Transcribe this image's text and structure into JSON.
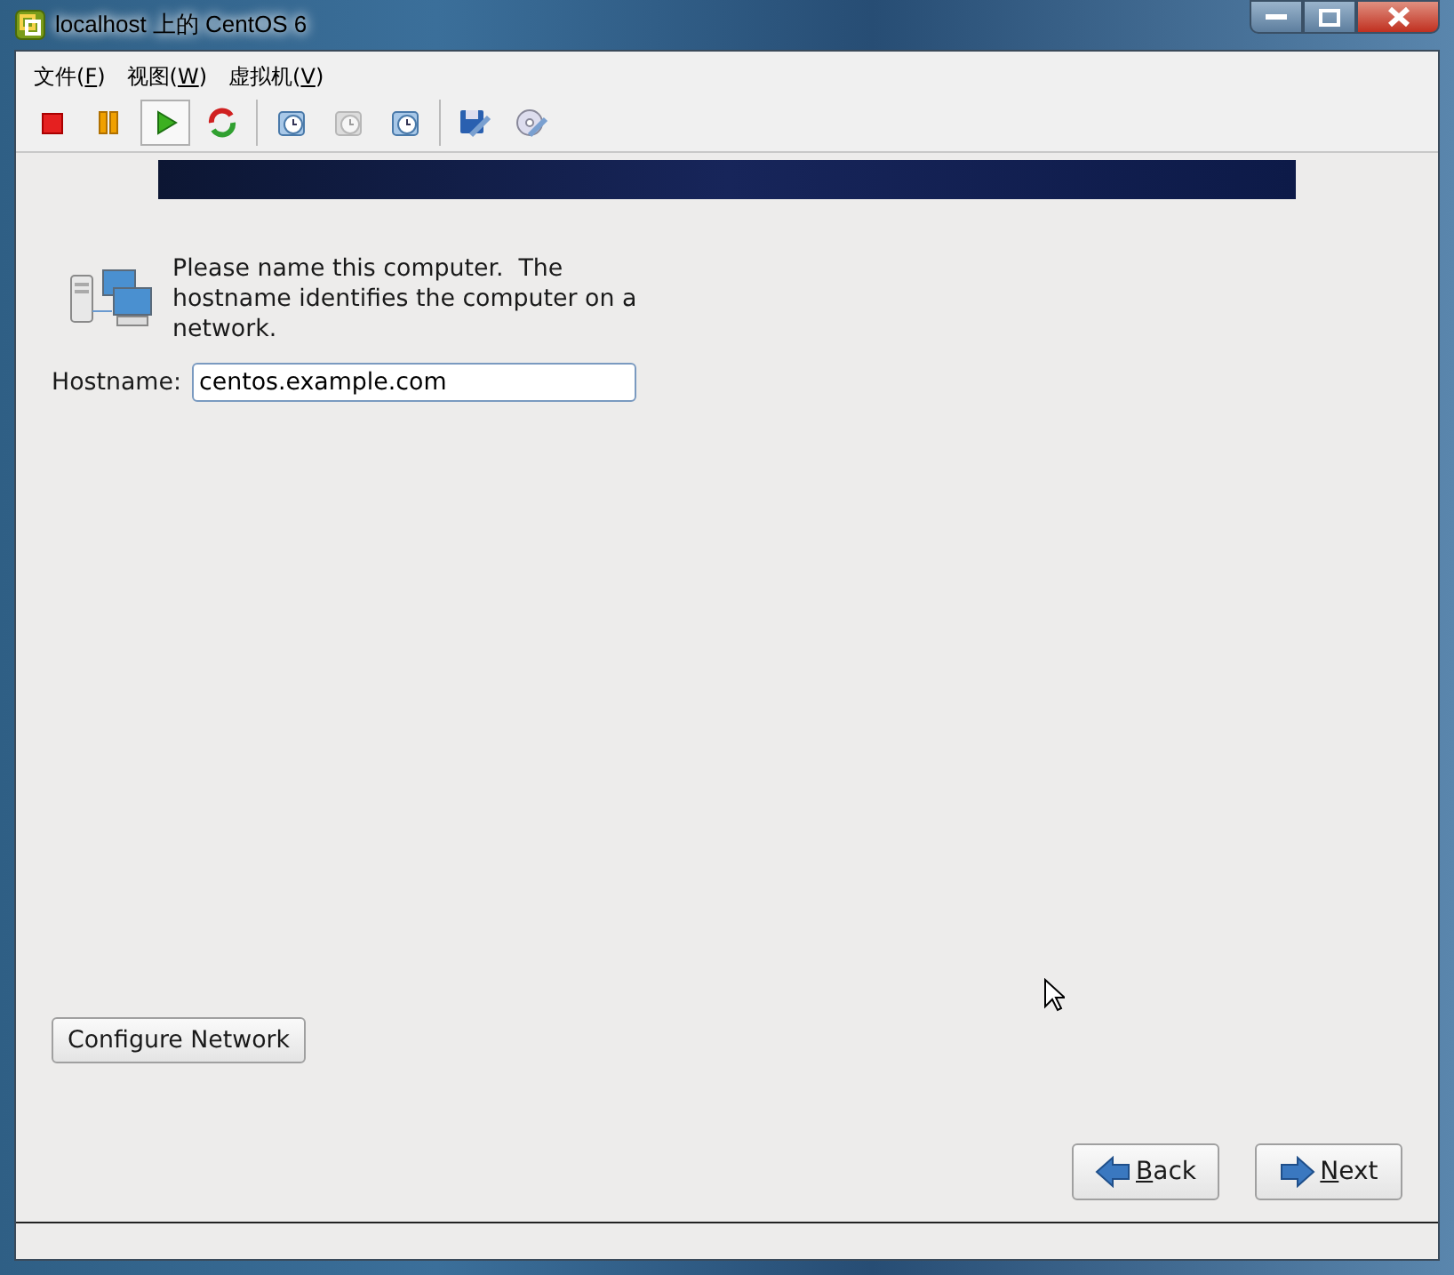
{
  "window": {
    "title": "localhost 上的 CentOS 6"
  },
  "menu": [
    {
      "prefix": "文件(",
      "key": "F",
      "suffix": ")"
    },
    {
      "prefix": "视图(",
      "key": "W",
      "suffix": ")"
    },
    {
      "prefix": "虚拟机(",
      "key": "V",
      "suffix": ")"
    }
  ],
  "toolbar": [
    {
      "kind": "stop",
      "selected": false,
      "disabled": false
    },
    {
      "kind": "pause",
      "selected": false,
      "disabled": false
    },
    {
      "kind": "play",
      "selected": true,
      "disabled": false
    },
    {
      "kind": "reset",
      "selected": false,
      "disabled": false
    },
    {
      "kind": "sep"
    },
    {
      "kind": "snapshot",
      "selected": false,
      "disabled": false
    },
    {
      "kind": "revert",
      "selected": false,
      "disabled": true
    },
    {
      "kind": "manage",
      "selected": false,
      "disabled": false
    },
    {
      "kind": "sep"
    },
    {
      "kind": "settings",
      "selected": false,
      "disabled": false
    },
    {
      "kind": "disc",
      "selected": false,
      "disabled": false
    }
  ],
  "intro": "Please name this computer.  The hostname identifies the computer on a network.",
  "hostname": {
    "label": "Hostname:",
    "value": "centos.example.com"
  },
  "configure_button": "Configure Network",
  "nav": [
    {
      "kind": "back",
      "key": "B",
      "rest": "ack"
    },
    {
      "kind": "next",
      "key": "N",
      "rest": "ext"
    }
  ]
}
